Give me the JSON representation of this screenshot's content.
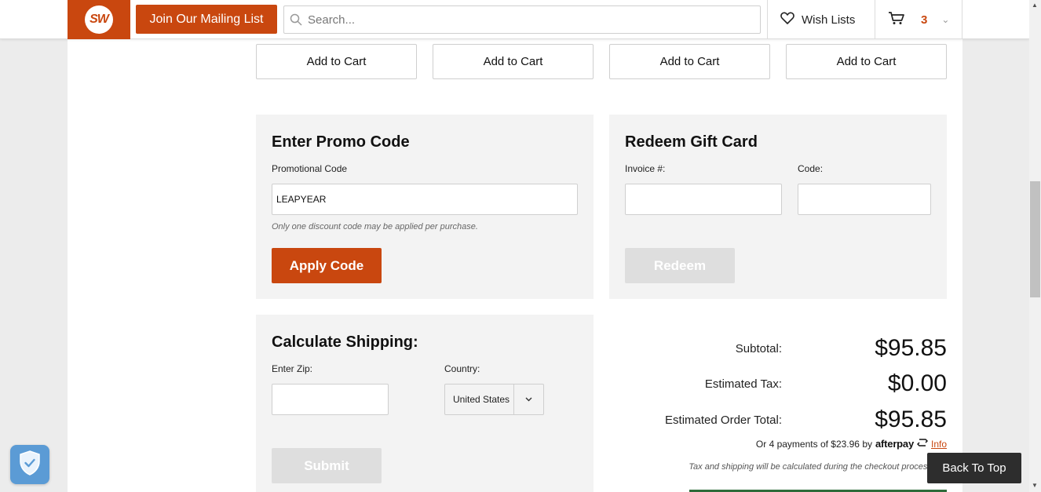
{
  "header": {
    "logo_text": "SW",
    "mailing_label": "Join Our Mailing List",
    "search_placeholder": "Search...",
    "wishlist_label": "Wish Lists",
    "cart_count": "3"
  },
  "product_row": {
    "add_to_cart_labels": [
      "Add to Cart",
      "Add to Cart",
      "Add to Cart",
      "Add to Cart"
    ]
  },
  "promo": {
    "title": "Enter Promo Code",
    "field_label": "Promotional Code",
    "value": "LEAPYEAR",
    "hint": "Only one discount code may be applied per purchase.",
    "apply_label": "Apply Code"
  },
  "gift_card": {
    "title": "Redeem Gift Card",
    "invoice_label": "Invoice #:",
    "code_label": "Code:",
    "invoice_value": "",
    "code_value": "",
    "redeem_label": "Redeem"
  },
  "shipping": {
    "title": "Calculate Shipping:",
    "zip_label": "Enter Zip:",
    "zip_value": "",
    "country_label": "Country:",
    "country_value": "United States",
    "submit_label": "Submit"
  },
  "totals": {
    "subtotal_label": "Subtotal:",
    "subtotal_value": "$95.85",
    "tax_label": "Estimated Tax:",
    "tax_value": "$0.00",
    "order_total_label": "Estimated Order Total:",
    "order_total_value": "$95.85",
    "installments_text": "Or 4 payments of $23.96 by",
    "afterpay_brand": "afterpay",
    "info_link": "Info",
    "tax_note": "Tax and shipping will be calculated during the checkout process."
  },
  "back_to_top_label": "Back To Top",
  "colors": {
    "brand_orange": "#c9470f",
    "panel_bg": "#f3f3f3",
    "shield_blue": "#5b9bd5"
  },
  "icons": {
    "search": "search-icon",
    "wishlist": "heart-icon",
    "cart": "cart-icon",
    "country_dropdown": "chevron-down-icon",
    "privacy": "shield-check-icon"
  }
}
